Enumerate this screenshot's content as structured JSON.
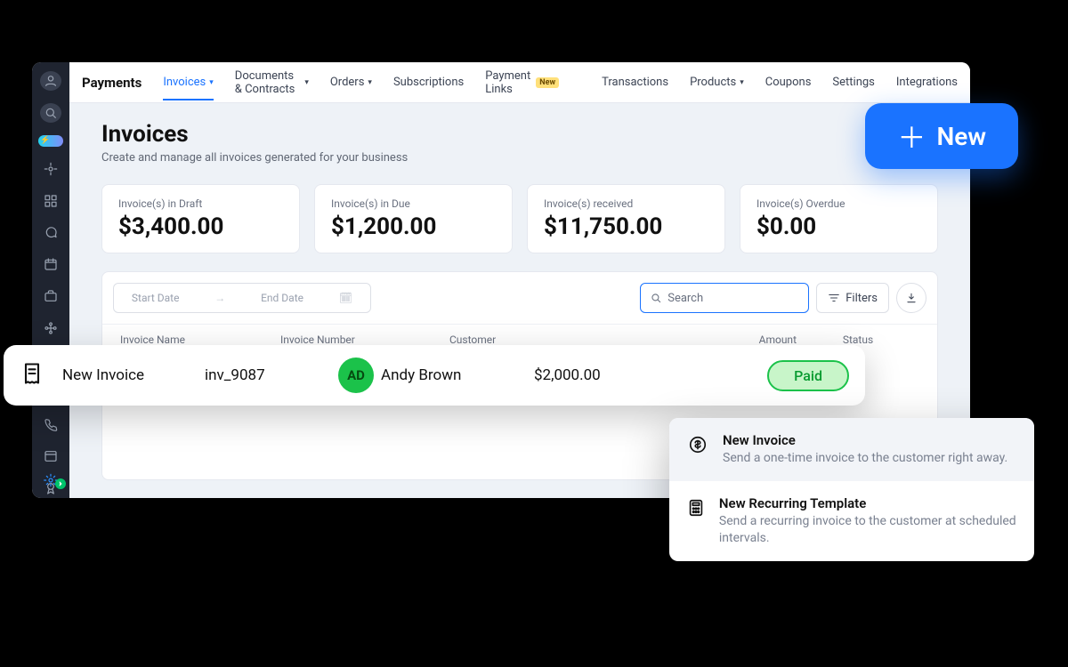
{
  "nav": {
    "brand": "Payments",
    "items": [
      {
        "label": "Invoices",
        "active": true,
        "caret": true
      },
      {
        "label": "Documents & Contracts",
        "caret": true
      },
      {
        "label": "Orders",
        "caret": true
      },
      {
        "label": "Subscriptions"
      },
      {
        "label": "Payment Links",
        "badge": "New"
      }
    ],
    "right_items": [
      {
        "label": "Transactions"
      },
      {
        "label": "Products",
        "caret": true
      },
      {
        "label": "Coupons"
      },
      {
        "label": "Settings"
      },
      {
        "label": "Integrations"
      }
    ]
  },
  "page": {
    "title": "Invoices",
    "subtitle": "Create and manage all invoices generated for your business"
  },
  "stats": [
    {
      "label": "Invoice(s) in Draft",
      "value": "$3,400.00"
    },
    {
      "label": "Invoice(s) in Due",
      "value": "$1,200.00"
    },
    {
      "label": "Invoice(s) received",
      "value": "$11,750.00"
    },
    {
      "label": "Invoice(s) Overdue",
      "value": "$0.00"
    }
  ],
  "toolbar": {
    "start_placeholder": "Start Date",
    "end_placeholder": "End Date",
    "search_placeholder": "Search",
    "filters_label": "Filters"
  },
  "columns": {
    "c1": "Invoice Name",
    "c2": "Invoice Number",
    "c3": "Customer",
    "c4": "Amount",
    "c5": "Status"
  },
  "hero_row": {
    "name": "New Invoice",
    "number": "inv_9087",
    "avatar_initials": "AD",
    "customer": "Andy Brown",
    "amount": "$2,000.00",
    "status": "Paid"
  },
  "new_button": {
    "label": "New"
  },
  "new_menu": [
    {
      "title": "New Invoice",
      "desc": "Send a one-time invoice to the customer right away.",
      "icon": "dollar",
      "hover": true
    },
    {
      "title": "New Recurring Template",
      "desc": "Send a recurring invoice to the customer at scheduled intervals.",
      "icon": "calc"
    }
  ]
}
